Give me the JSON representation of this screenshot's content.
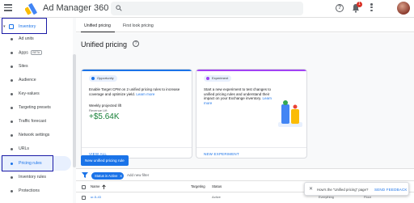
{
  "app": {
    "title": "Ad Manager 360"
  },
  "header": {
    "notification_count": "1"
  },
  "sidebar": {
    "inventory_label": "Inventory",
    "items": [
      {
        "label": "Ad units"
      },
      {
        "label": "Apps",
        "badge": "BETA"
      },
      {
        "label": "Sites"
      },
      {
        "label": "Audience"
      },
      {
        "label": "Key-values"
      },
      {
        "label": "Targeting presets"
      },
      {
        "label": "Traffic forecast"
      },
      {
        "label": "Network settings"
      },
      {
        "label": "URLs"
      },
      {
        "label": "Pricing rules"
      },
      {
        "label": "Inventory rules"
      },
      {
        "label": "Protections"
      }
    ]
  },
  "tabs": [
    {
      "label": "Unified pricing"
    },
    {
      "label": "First look pricing"
    }
  ],
  "main": {
    "title": "Unified pricing",
    "opportunity_card": {
      "tag": "Opportunity",
      "desc": "Enable Target CPM on 2 unified pricing rules to increase coverage and optimize yield.",
      "learn_more": "Learn more",
      "sub_label": "Weekly projected lift",
      "sub_label2": "Revenue Lift",
      "value": "+$5.64K",
      "link": "VIEW ALL"
    },
    "experiment_card": {
      "tag": "Experiment",
      "desc": "Start a new experiment to test changes to unified pricing rules and understand their impact on your Exchange inventory.",
      "learn_more": "Learn more",
      "link": "NEW EXPERIMENT"
    },
    "create_button": "New unified pricing rule",
    "filter": {
      "chip": "Status is Active",
      "add": "Add new filter"
    },
    "table": {
      "columns": [
        "Name",
        "Targeting",
        "Status"
      ],
      "row": {
        "name": "ur-5-43",
        "status": "Active",
        "col4": "Everything",
        "col5": "Floor"
      }
    }
  },
  "toast": {
    "message": "How's the \"Unified pricing\" page?",
    "action": "SEND FEEDBACK"
  },
  "colors": {
    "accent": "#1a73e8",
    "positive": "#188038",
    "highlight_box": "#1a1aa6"
  }
}
